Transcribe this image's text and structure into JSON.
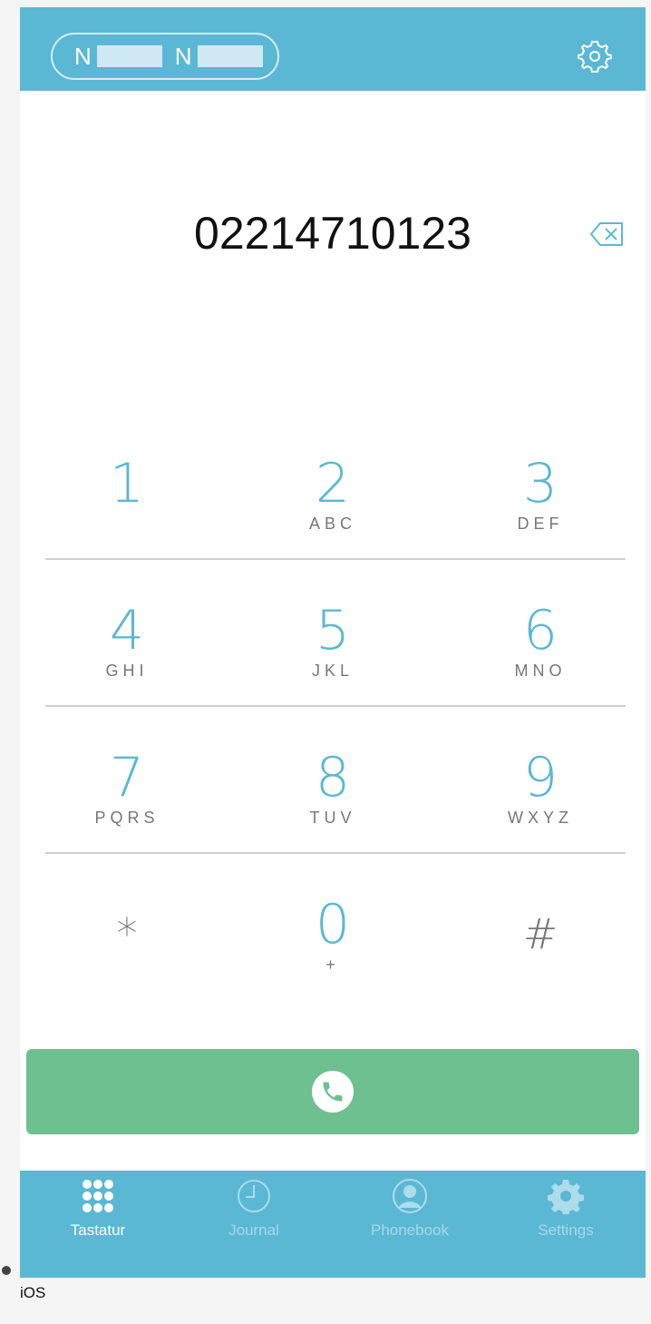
{
  "header": {
    "account_letter_1": "N",
    "account_letter_2": "N",
    "settings_icon": "gear-icon"
  },
  "dialer": {
    "number": "02214710123",
    "backspace_icon": "backspace-icon"
  },
  "keypad": {
    "k1": {
      "digit": "1",
      "letters": ""
    },
    "k2": {
      "digit": "2",
      "letters": "ABC"
    },
    "k3": {
      "digit": "3",
      "letters": "DEF"
    },
    "k4": {
      "digit": "4",
      "letters": "GHI"
    },
    "k5": {
      "digit": "5",
      "letters": "JKL"
    },
    "k6": {
      "digit": "6",
      "letters": "MNO"
    },
    "k7": {
      "digit": "7",
      "letters": "PQRS"
    },
    "k8": {
      "digit": "8",
      "letters": "TUV"
    },
    "k9": {
      "digit": "9",
      "letters": "WXYZ"
    },
    "kstar": {
      "digit": "*",
      "letters": ""
    },
    "k0": {
      "digit": "0",
      "letters": "+"
    },
    "khash": {
      "digit": "#",
      "letters": ""
    }
  },
  "call": {
    "icon": "phone-icon",
    "color": "#6ec090"
  },
  "tabbar": {
    "tabs": [
      {
        "label": "Tastatur",
        "icon": "keypad-icon",
        "active": true
      },
      {
        "label": "Journal",
        "icon": "clock-icon",
        "active": false
      },
      {
        "label": "Phonebook",
        "icon": "contact-icon",
        "active": false
      },
      {
        "label": "Settings",
        "icon": "gear-icon",
        "active": false
      }
    ]
  },
  "platform_label": "iOS",
  "colors": {
    "accent": "#5bb8d4",
    "call": "#6ec090"
  }
}
